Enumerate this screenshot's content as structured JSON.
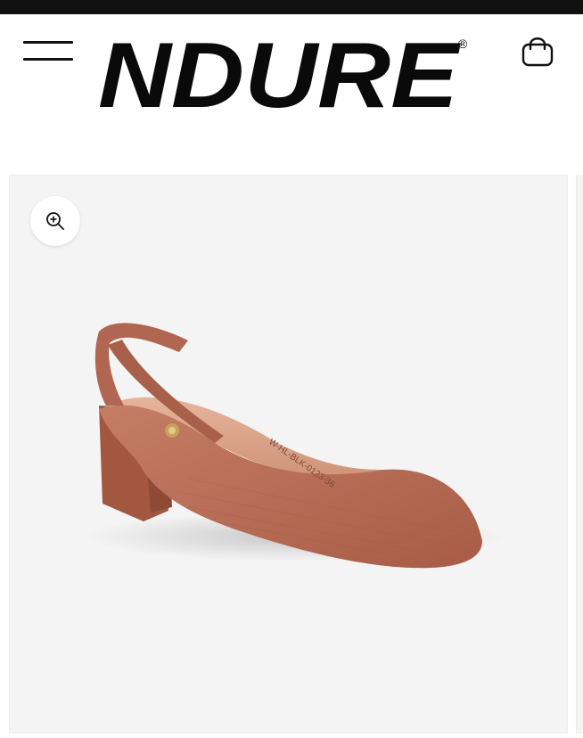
{
  "header": {
    "menu_icon": "hamburger-menu-icon",
    "logo_text": "NDURE",
    "logo_mark": "®",
    "cart_icon": "shopping-bag-icon"
  },
  "gallery": {
    "zoom_icon": "zoom-in-icon",
    "product_image": {
      "subject": "block-heel slingback shoe",
      "color": "#b76a55",
      "stamp_text": "W-HL-BLK-0123-36"
    }
  },
  "colors": {
    "topbar": "#111111",
    "gallery_bg": "#f4f4f4",
    "shoe": "#b76a55",
    "logo": "#0a0a0a"
  }
}
